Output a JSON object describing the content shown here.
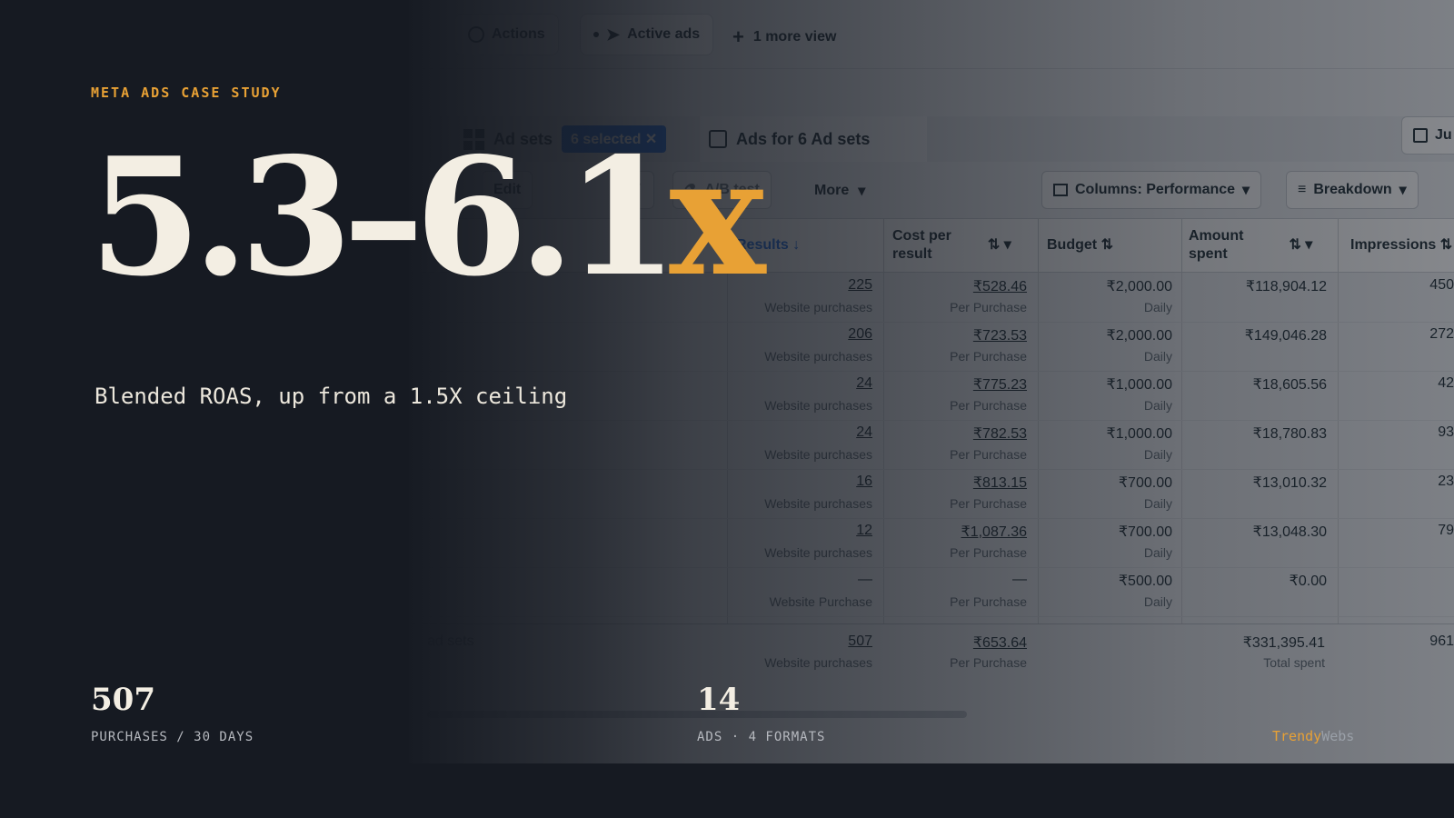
{
  "background_ui": {
    "top_bar": {
      "actions_label": "Actions",
      "active_ads_label": "Active ads",
      "more_view_label": "1 more view"
    },
    "level_tabs": {
      "ad_sets_label": "Ad sets",
      "selected_badge": "6 selected",
      "ads_tab_label": "Ads for 6 Ad sets",
      "date_partial": "Ju"
    },
    "toolbar": {
      "edit_label": "Edit",
      "ab_test_label": "A/B test",
      "more_label": "More",
      "columns_label": "Columns: Performance",
      "breakdown_label": "Breakdown"
    },
    "table": {
      "headers": {
        "results": "Results",
        "cost_per_result_line1": "Cost per",
        "cost_per_result_line2": "result",
        "budget": "Budget",
        "amount_spent_line1": "Amount",
        "amount_spent_line2": "spent",
        "impressions": "Impressions"
      },
      "rows": [
        {
          "results": "225",
          "results_sub": "Website purchases",
          "cost": "₹528.46",
          "cost_sub": "Per Purchase",
          "budget": "₹2,000.00",
          "budget_sub": "Daily",
          "spent": "₹118,904.12",
          "impr": "450"
        },
        {
          "results": "206",
          "results_sub": "Website purchases",
          "cost": "₹723.53",
          "cost_sub": "Per Purchase",
          "budget": "₹2,000.00",
          "budget_sub": "Daily",
          "spent": "₹149,046.28",
          "impr": "272"
        },
        {
          "results": "24",
          "results_sub": "Website purchases",
          "cost": "₹775.23",
          "cost_sub": "Per Purchase",
          "budget": "₹1,000.00",
          "budget_sub": "Daily",
          "spent": "₹18,605.56",
          "impr": "42"
        },
        {
          "results": "24",
          "results_sub": "Website purchases",
          "cost": "₹782.53",
          "cost_sub": "Per Purchase",
          "budget": "₹1,000.00",
          "budget_sub": "Daily",
          "spent": "₹18,780.83",
          "impr": "93"
        },
        {
          "results": "16",
          "results_sub": "Website purchases",
          "cost": "₹813.15",
          "cost_sub": "Per Purchase",
          "budget": "₹700.00",
          "budget_sub": "Daily",
          "spent": "₹13,010.32",
          "impr": "23"
        },
        {
          "results": "12",
          "results_sub": "Website purchases",
          "cost": "₹1,087.36",
          "cost_sub": "Per Purchase",
          "budget": "₹700.00",
          "budget_sub": "Daily",
          "spent": "₹13,048.30",
          "impr": "79"
        },
        {
          "results": "—",
          "results_sub": "Website Purchase",
          "cost": "—",
          "cost_sub": "Per Purchase",
          "budget": "₹500.00",
          "budget_sub": "Daily",
          "spent": "₹0.00",
          "impr": ""
        }
      ],
      "totals": {
        "label": "ad sets",
        "results": "507",
        "results_sub": "Website purchases",
        "cost": "₹653.64",
        "cost_sub": "Per Purchase",
        "spent": "₹331,395.41",
        "spent_sub": "Total spent",
        "impr": "961"
      }
    }
  },
  "overlay": {
    "eyebrow": "META ADS CASE STUDY",
    "headline_main": "5.3–6.1",
    "headline_suffix": "x",
    "subtitle": "Blended ROAS, up from a 1.5X ceiling",
    "stats": [
      {
        "value": "507",
        "label": "PURCHASES / 30 DAYS"
      },
      {
        "value": "14",
        "label": "ADS · 4 FORMATS"
      }
    ],
    "brand_part1": "Trendy",
    "brand_part2": "Webs"
  },
  "colors": {
    "accent": "#e8a135",
    "cream": "#f3eee3",
    "dark_bg": "#161a22",
    "link_blue": "#0a66d8"
  }
}
